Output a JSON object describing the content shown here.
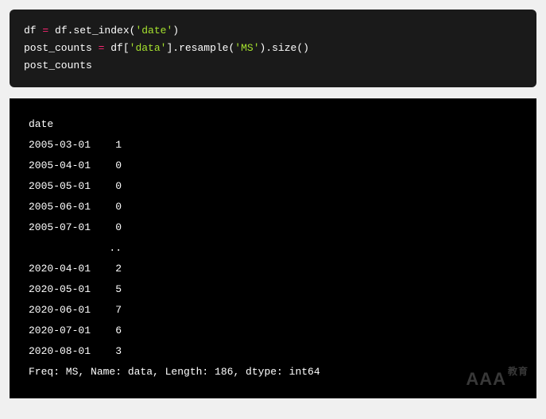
{
  "code": {
    "line1": {
      "t1": "df ",
      "t2": "=",
      "t3": " df.set_index(",
      "t4": "'date'",
      "t5": ")"
    },
    "line2": {
      "t1": "post_counts ",
      "t2": "=",
      "t3": " df[",
      "t4": "'data'",
      "t5": "].resample(",
      "t6": "'MS'",
      "t7": ").size()"
    },
    "line3": {
      "t1": "post_counts"
    }
  },
  "output": {
    "header": "date",
    "rows": [
      {
        "date": "2005-03-01",
        "val": "1"
      },
      {
        "date": "2005-04-01",
        "val": "0"
      },
      {
        "date": "2005-05-01",
        "val": "0"
      },
      {
        "date": "2005-06-01",
        "val": "0"
      },
      {
        "date": "2005-07-01",
        "val": "0"
      }
    ],
    "ellipsis": "             ..",
    "rows2": [
      {
        "date": "2020-04-01",
        "val": "2"
      },
      {
        "date": "2020-05-01",
        "val": "5"
      },
      {
        "date": "2020-06-01",
        "val": "7"
      },
      {
        "date": "2020-07-01",
        "val": "6"
      },
      {
        "date": "2020-08-01",
        "val": "3"
      }
    ],
    "footer": "Freq: MS, Name: data, Length: 186, dtype: int64"
  },
  "watermark": {
    "main": "AAA",
    "sub": "教育"
  },
  "chart_data": {
    "type": "table",
    "title": "post_counts (pandas Series)",
    "index_name": "date",
    "freq": "MS",
    "name": "data",
    "length": 186,
    "dtype": "int64",
    "rows_shown": [
      {
        "date": "2005-03-01",
        "value": 1
      },
      {
        "date": "2005-04-01",
        "value": 0
      },
      {
        "date": "2005-05-01",
        "value": 0
      },
      {
        "date": "2005-06-01",
        "value": 0
      },
      {
        "date": "2005-07-01",
        "value": 0
      },
      {
        "date": "2020-04-01",
        "value": 2
      },
      {
        "date": "2020-05-01",
        "value": 5
      },
      {
        "date": "2020-06-01",
        "value": 7
      },
      {
        "date": "2020-07-01",
        "value": 6
      },
      {
        "date": "2020-08-01",
        "value": 3
      }
    ]
  }
}
